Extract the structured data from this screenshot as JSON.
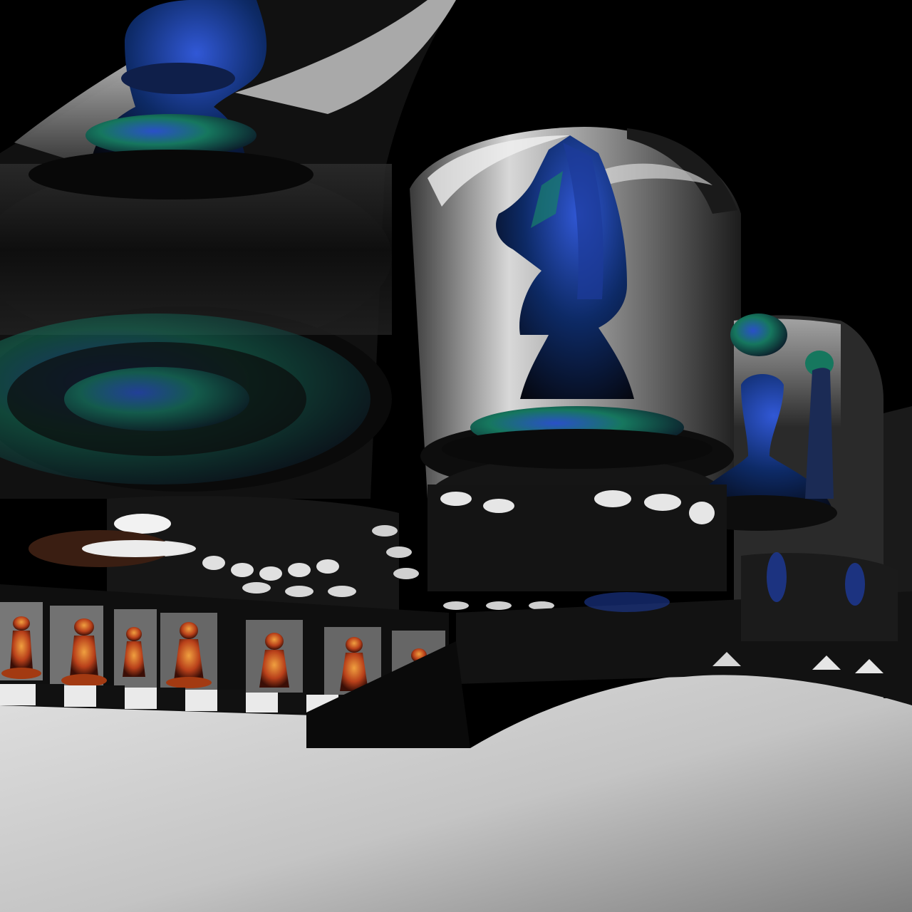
{
  "scene": {
    "description_visible_text": "",
    "palette": {
      "background": "#000000",
      "floor_light": "#d8d8d8",
      "floor_dark": "#8c8c8c",
      "chrome_light": "#e6e6e6",
      "chrome_mid": "#8a8a8a",
      "chrome_dark": "#1a1a1a",
      "iridescent_blue": "#1e3c9a",
      "iridescent_green": "#1f8a6a",
      "amber": "#c8501a",
      "wood": "#3a1e12"
    },
    "objects": [
      "bishop-piece",
      "knight-piece",
      "pawn-piece-right",
      "reflected-pawn-row",
      "chrome-tube-left",
      "chrome-tube-center",
      "chrome-tube-right",
      "perforated-ring",
      "floor-plane"
    ]
  }
}
